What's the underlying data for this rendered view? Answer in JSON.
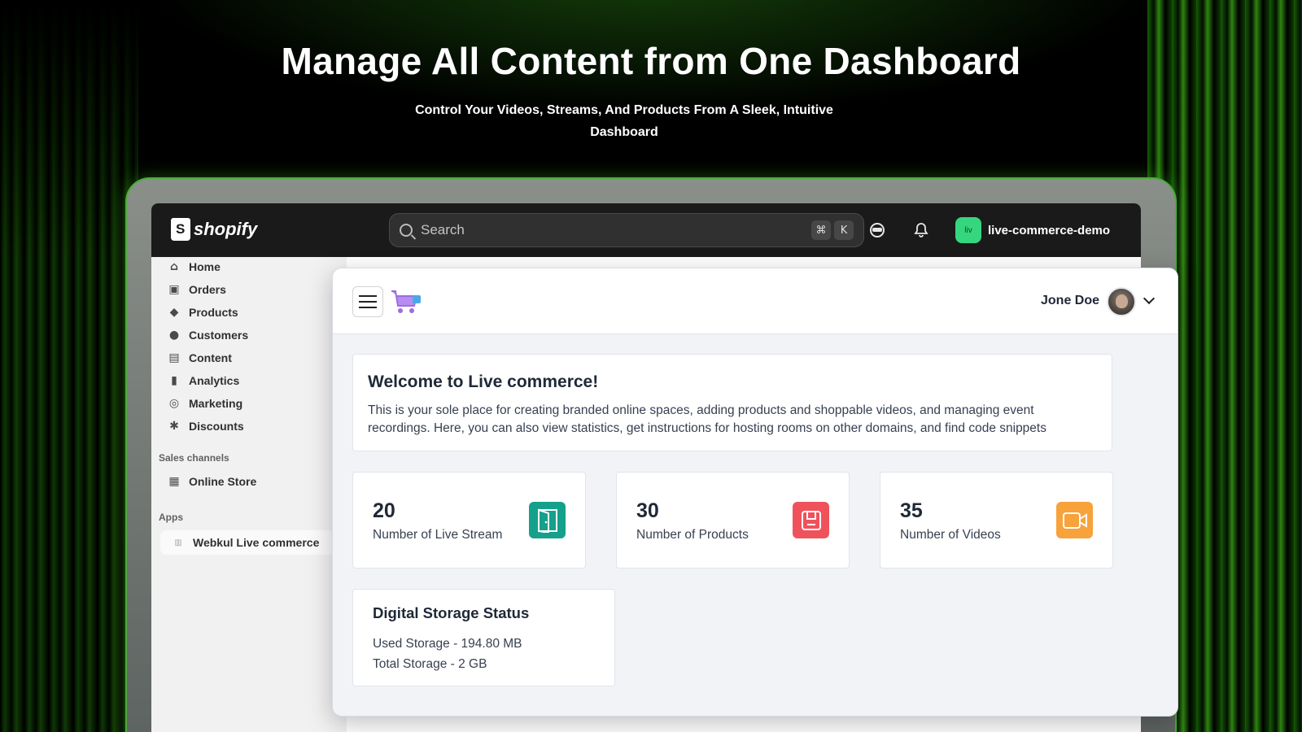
{
  "hero": {
    "title": "Manage All Content from One Dashboard",
    "subtitle": "Control Your Videos, Streams, And Products From A Sleek, Intuitive Dashboard"
  },
  "shopify": {
    "brand": "shopify",
    "search_placeholder": "Search",
    "shortcut_keys": [
      "⌘",
      "K"
    ],
    "store_avatar": "liv",
    "store_name": "live-commerce-demo",
    "nav": [
      "Home",
      "Orders",
      "Products",
      "Customers",
      "Content",
      "Analytics",
      "Marketing",
      "Discounts"
    ],
    "sales_channels_label": "Sales channels",
    "sales_channels": [
      "Online Store"
    ],
    "apps_label": "Apps",
    "apps": [
      "Webkul Live commerce"
    ]
  },
  "app": {
    "user_name": "Jone Doe",
    "welcome_title": "Welcome to Live commerce!",
    "welcome_text": "This is your sole place for creating branded online spaces, adding products and shoppable videos, and managing event recordings. Here, you can also view statistics, get instructions for hosting rooms on other domains, and find code snippets",
    "stats": [
      {
        "value": "20",
        "label": "Number of Live Stream",
        "color": "#14a08a",
        "icon": "door-icon"
      },
      {
        "value": "30",
        "label": "Number of Products",
        "color": "#f0525b",
        "icon": "box-icon"
      },
      {
        "value": "35",
        "label": "Number of Videos",
        "color": "#f7a23b",
        "icon": "video-camera-icon"
      }
    ],
    "storage": {
      "title": "Digital Storage Status",
      "used": "Used Storage - 194.80 MB",
      "total": "Total Storage - 2 GB"
    }
  },
  "colors": {
    "accent_green": "#4caa3a",
    "topbar": "#1a1a1a",
    "store_avatar": "#36d67e"
  }
}
